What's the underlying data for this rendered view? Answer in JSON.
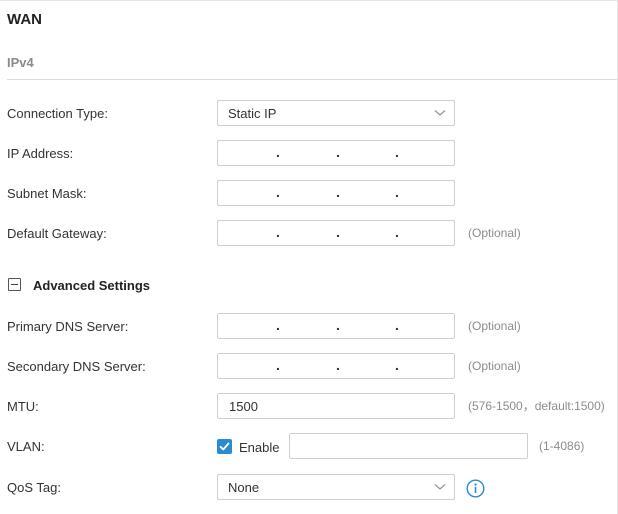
{
  "page": {
    "title": "WAN",
    "section": "IPv4"
  },
  "form": {
    "connection_type": {
      "label": "Connection Type:",
      "value": "Static IP"
    },
    "ip_address": {
      "label": "IP Address:"
    },
    "subnet_mask": {
      "label": "Subnet Mask:"
    },
    "default_gateway": {
      "label": "Default Gateway:",
      "hint": "(Optional)"
    },
    "ip_separator": "."
  },
  "advanced": {
    "toggle_label": "Advanced Settings",
    "primary_dns": {
      "label": "Primary DNS Server:",
      "hint": "(Optional)"
    },
    "secondary_dns": {
      "label": "Secondary DNS Server:",
      "hint": "(Optional)"
    },
    "mtu": {
      "label": "MTU:",
      "value": "1500",
      "hint": "(576-1500，default:1500)"
    },
    "vlan": {
      "label": "VLAN:",
      "enable_label": "Enable",
      "enabled": true,
      "value": "",
      "hint": "(1-4086)"
    },
    "qos_tag": {
      "label": "QoS Tag:",
      "value": "None"
    }
  },
  "colors": {
    "accent": "#2a8bd0",
    "border": "#cfcfcf",
    "hint": "#8c8c8c"
  },
  "icons": {
    "dropdown": "chevron-down-icon",
    "collapse": "minus-square-icon",
    "check": "checkmark-icon",
    "info": "info-circle-icon"
  }
}
